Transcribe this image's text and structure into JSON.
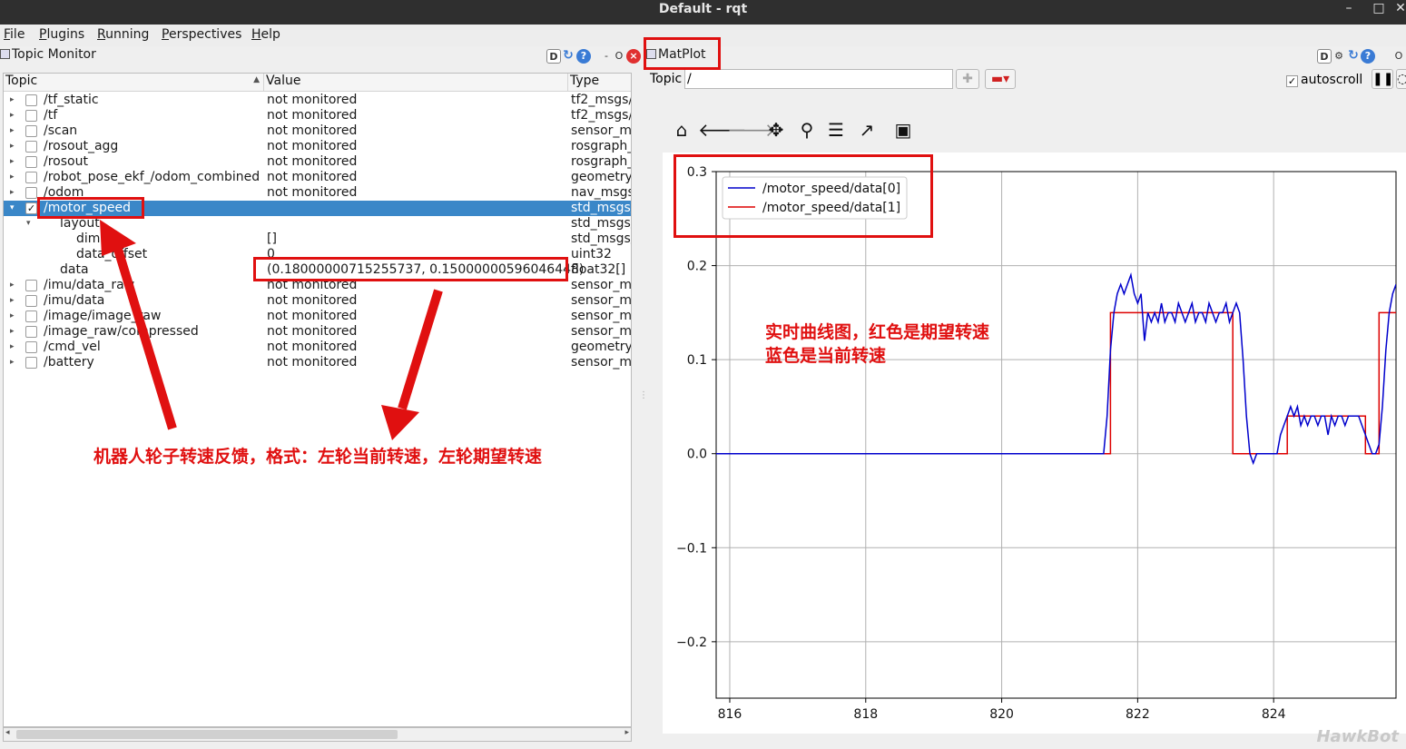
{
  "window": {
    "title": "Default - rqt"
  },
  "menu": [
    "File",
    "Plugins",
    "Running",
    "Perspectives",
    "Help"
  ],
  "topic_monitor": {
    "title": "Topic Monitor",
    "dock_buttons": [
      "D",
      "C",
      "?",
      "-",
      "O"
    ],
    "columns": [
      "Topic",
      "Value",
      "Type"
    ],
    "rows": [
      {
        "topic": "/tf_static",
        "value": "not monitored",
        "type": "tf2_msgs/",
        "expander": "▸",
        "checked": false,
        "indent": 0
      },
      {
        "topic": "/tf",
        "value": "not monitored",
        "type": "tf2_msgs/",
        "expander": "▸",
        "checked": false,
        "indent": 0
      },
      {
        "topic": "/scan",
        "value": "not monitored",
        "type": "sensor_ms",
        "expander": "▸",
        "checked": false,
        "indent": 0
      },
      {
        "topic": "/rosout_agg",
        "value": "not monitored",
        "type": "rosgraph_",
        "expander": "▸",
        "checked": false,
        "indent": 0
      },
      {
        "topic": "/rosout",
        "value": "not monitored",
        "type": "rosgraph_",
        "expander": "▸",
        "checked": false,
        "indent": 0
      },
      {
        "topic": "/robot_pose_ekf_/odom_combined",
        "value": "not monitored",
        "type": "geometry",
        "expander": "▸",
        "checked": false,
        "indent": 0
      },
      {
        "topic": "/odom",
        "value": "not monitored",
        "type": "nav_msgs",
        "expander": "▸",
        "checked": false,
        "indent": 0
      },
      {
        "topic": "/motor_speed",
        "value": "",
        "type": "std_msgs/",
        "expander": "▾",
        "checked": true,
        "indent": 0,
        "selected": true
      },
      {
        "topic": "layout",
        "value": "",
        "type": "std_msgs/",
        "expander": "▾",
        "checked": null,
        "indent": 1
      },
      {
        "topic": "dim",
        "value": "[]",
        "type": "std_msgs/",
        "expander": "",
        "checked": null,
        "indent": 2
      },
      {
        "topic": "data_offset",
        "value": "0",
        "type": "uint32",
        "expander": "",
        "checked": null,
        "indent": 2
      },
      {
        "topic": "data",
        "value": "(0.18000000715255737, 0.15000000596046448)",
        "type": "float32[]",
        "expander": "",
        "checked": null,
        "indent": 1
      },
      {
        "topic": "/imu/data_raw",
        "value": "not monitored",
        "type": "sensor_ms",
        "expander": "▸",
        "checked": false,
        "indent": 0
      },
      {
        "topic": "/imu/data",
        "value": "not monitored",
        "type": "sensor_ms",
        "expander": "▸",
        "checked": false,
        "indent": 0
      },
      {
        "topic": "/image/image_raw",
        "value": "not monitored",
        "type": "sensor_ms",
        "expander": "▸",
        "checked": false,
        "indent": 0
      },
      {
        "topic": "/image_raw/compressed",
        "value": "not monitored",
        "type": "sensor_ms",
        "expander": "▸",
        "checked": false,
        "indent": 0
      },
      {
        "topic": "/cmd_vel",
        "value": "not monitored",
        "type": "geometry",
        "expander": "▸",
        "checked": false,
        "indent": 0
      },
      {
        "topic": "/battery",
        "value": "not monitored",
        "type": "sensor_ms",
        "expander": "▸",
        "checked": false,
        "indent": 0
      }
    ]
  },
  "matplot": {
    "title": "MatPlot",
    "topic_label": "Topic",
    "topic_value": "/",
    "autoscroll_label": "autoscroll",
    "autoscroll_checked": true,
    "tool_icons": [
      "home-icon",
      "back-icon",
      "forward-icon",
      "pan-icon",
      "zoom-icon",
      "configure-subplots-icon",
      "edit-axis-icon",
      "save-icon"
    ]
  },
  "chart_data": {
    "type": "line",
    "title": "",
    "xlabel": "",
    "ylabel": "",
    "xlim": [
      815.8,
      825.8
    ],
    "ylim": [
      -0.26,
      0.3
    ],
    "xticks": [
      816,
      818,
      820,
      822,
      824
    ],
    "yticks": [
      0.3,
      0.2,
      0.1,
      0.0,
      -0.1,
      -0.2
    ],
    "ytick_labels": [
      "0.3",
      "0.2",
      "0.1",
      "0.0",
      "−0.1",
      "−0.2"
    ],
    "grid": true,
    "legend_position": "top-left",
    "series": [
      {
        "name": "/motor_speed/data[0]",
        "color": "#0000cc",
        "x": [
          815.8,
          821.5,
          821.55,
          821.6,
          821.65,
          821.7,
          821.75,
          821.8,
          821.85,
          821.9,
          821.95,
          822.0,
          822.05,
          822.1,
          822.15,
          822.2,
          822.25,
          822.3,
          822.35,
          822.4,
          822.45,
          822.5,
          822.55,
          822.6,
          822.65,
          822.7,
          822.75,
          822.8,
          822.85,
          822.9,
          822.95,
          823.0,
          823.05,
          823.1,
          823.15,
          823.2,
          823.25,
          823.3,
          823.35,
          823.4,
          823.45,
          823.5,
          823.55,
          823.6,
          823.65,
          823.7,
          823.75,
          823.8,
          823.85,
          823.9,
          824.0,
          824.05,
          824.1,
          824.15,
          824.2,
          824.25,
          824.3,
          824.35,
          824.4,
          824.45,
          824.5,
          824.55,
          824.6,
          824.65,
          824.7,
          824.75,
          824.8,
          824.85,
          824.9,
          824.95,
          825.0,
          825.05,
          825.1,
          825.15,
          825.2,
          825.25,
          825.3,
          825.35,
          825.4,
          825.45,
          825.5,
          825.55,
          825.6,
          825.65,
          825.7,
          825.75,
          825.8
        ],
        "y": [
          0.0,
          0.0,
          0.04,
          0.11,
          0.15,
          0.17,
          0.18,
          0.17,
          0.18,
          0.19,
          0.17,
          0.16,
          0.17,
          0.12,
          0.15,
          0.14,
          0.15,
          0.14,
          0.16,
          0.14,
          0.15,
          0.15,
          0.14,
          0.16,
          0.15,
          0.14,
          0.15,
          0.16,
          0.14,
          0.15,
          0.15,
          0.14,
          0.16,
          0.15,
          0.14,
          0.15,
          0.15,
          0.16,
          0.14,
          0.15,
          0.16,
          0.15,
          0.1,
          0.04,
          0.0,
          -0.01,
          0.0,
          0.0,
          0.0,
          0.0,
          0.0,
          0.0,
          0.02,
          0.03,
          0.04,
          0.05,
          0.04,
          0.05,
          0.03,
          0.04,
          0.03,
          0.04,
          0.04,
          0.03,
          0.04,
          0.04,
          0.02,
          0.04,
          0.03,
          0.04,
          0.04,
          0.03,
          0.04,
          0.04,
          0.04,
          0.04,
          0.03,
          0.02,
          0.01,
          0.0,
          0.0,
          0.01,
          0.05,
          0.11,
          0.15,
          0.17,
          0.18
        ]
      },
      {
        "name": "/motor_speed/data[1]",
        "color": "#dd0000",
        "x": [
          815.8,
          821.5,
          821.6,
          821.6,
          823.4,
          823.4,
          823.75,
          823.75,
          824.2,
          824.2,
          825.35,
          825.35,
          825.55,
          825.55,
          825.8
        ],
        "y": [
          0.0,
          0.0,
          0.0,
          0.15,
          0.15,
          0.0,
          0.0,
          0.0,
          0.0,
          0.04,
          0.04,
          0.0,
          0.0,
          0.15,
          0.15
        ]
      }
    ]
  },
  "annotations": {
    "feedback_text": "机器人轮子转速反馈，格式：左轮当前转速，左轮期望转速",
    "curve_text_line1": "实时曲线图，红色是期望转速",
    "curve_text_line2": "蓝色是当前转速",
    "accent_color": "#e01010"
  },
  "watermark": "HawkBot"
}
